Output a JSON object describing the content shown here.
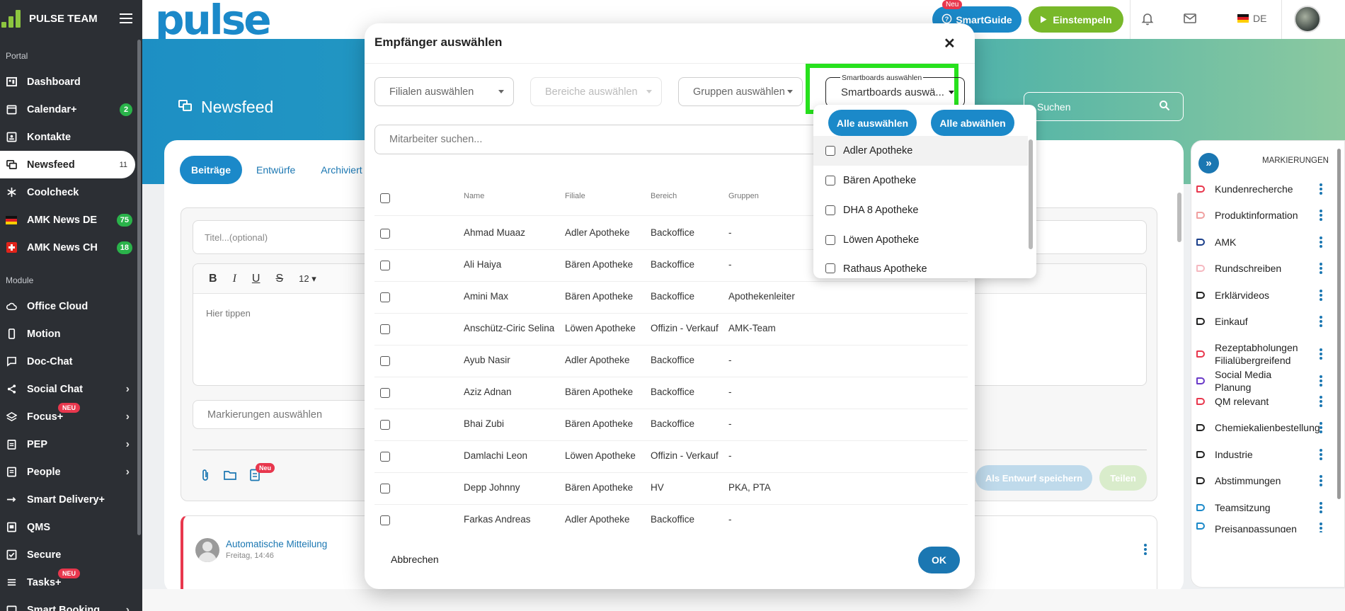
{
  "sidebar": {
    "title": "PULSE TEAM",
    "section_portal": "Portal",
    "section_module": "Module",
    "portal_items": [
      {
        "label": "Dashboard"
      },
      {
        "label": "Calendar+",
        "badge": "2"
      },
      {
        "label": "Kontakte"
      },
      {
        "label": "Newsfeed",
        "count": "11"
      },
      {
        "label": "Coolcheck"
      },
      {
        "label": "AMK News DE",
        "badge": "75"
      },
      {
        "label": "AMK News CH",
        "badge": "18"
      }
    ],
    "module_items": [
      {
        "label": "Office Cloud"
      },
      {
        "label": "Motion"
      },
      {
        "label": "Doc-Chat"
      },
      {
        "label": "Social Chat"
      },
      {
        "label": "Focus+",
        "neu": "NEU"
      },
      {
        "label": "PEP"
      },
      {
        "label": "People"
      },
      {
        "label": "Smart Delivery+"
      },
      {
        "label": "QMS"
      },
      {
        "label": "Secure"
      },
      {
        "label": "Tasks+",
        "neu": "NEU"
      },
      {
        "label": "Smart Booking"
      }
    ]
  },
  "topbar": {
    "brand": "pulse",
    "smartguide_label": "SmartGuide",
    "smartguide_badge": "Neu",
    "stamp_label": "Einstempeln",
    "lang": "DE"
  },
  "page": {
    "title": "Newsfeed",
    "search_placeholder": "Suchen",
    "tabs": [
      "Beiträge",
      "Entwürfe",
      "Archiviert"
    ],
    "title_placeholder": "Titel...(optional)",
    "font_size": "12",
    "editor_placeholder": "Hier tippen",
    "marks_placeholder": "Markierungen auswählen",
    "attach_badge": "Neu",
    "draft_button": "Als Entwurf speichern",
    "share_button": "Teilen",
    "post_author": "Automatische Mitteilung",
    "post_date": "Freitag, 14:46"
  },
  "right_panel": {
    "title": "MARKIERUNGEN",
    "items": [
      {
        "label": "Kundenrecherche",
        "color": "#e8374d"
      },
      {
        "label": "Produktinformation",
        "color": "#f0a0a0"
      },
      {
        "label": "AMK",
        "color": "#1b3f8a"
      },
      {
        "label": "Rundschreiben",
        "color": "#f5b8c0"
      },
      {
        "label": "Erklärvideos",
        "color": "#222222"
      },
      {
        "label": "Einkauf",
        "color": "#222222"
      },
      {
        "label": "Rezeptabholungen Filialübergreifend",
        "color": "#e8374d"
      },
      {
        "label": "Social Media Planung",
        "color": "#6a3ac8"
      },
      {
        "label": "QM relevant",
        "color": "#e8374d"
      },
      {
        "label": "Chemiekalienbestellung",
        "color": "#222222"
      },
      {
        "label": "Industrie",
        "color": "#222222"
      },
      {
        "label": "Abstimmungen",
        "color": "#222222"
      },
      {
        "label": "Teamsitzung",
        "color": "#1b89c9"
      },
      {
        "label": "Preisanpassungen",
        "color": "#1b89c9"
      }
    ]
  },
  "modal": {
    "title": "Empfänger auswählen",
    "filter_branches": "Filialen auswählen",
    "filter_areas": "Bereiche auswählen",
    "filter_groups": "Gruppen auswählen",
    "smartboards_label": "Smartboards auswählen",
    "smartboards_value": "Smartboards auswä...",
    "search_placeholder": "Mitarbeiter suchen...",
    "columns": [
      "Name",
      "Filiale",
      "Bereich",
      "Gruppen"
    ],
    "rows": [
      {
        "name": "Ahmad Muaaz",
        "branch": "Adler Apotheke",
        "area": "Backoffice",
        "groups": "-"
      },
      {
        "name": "Ali Haiya",
        "branch": "Bären Apotheke",
        "area": "Backoffice",
        "groups": "-"
      },
      {
        "name": "Amini Max",
        "branch": "Bären Apotheke",
        "area": "Backoffice",
        "groups": "Apothekenleiter"
      },
      {
        "name": "Anschütz-Ciric Selina",
        "branch": "Löwen Apotheke",
        "area": "Offizin - Verkauf",
        "groups": "AMK-Team"
      },
      {
        "name": "Ayub Nasir",
        "branch": "Adler Apotheke",
        "area": "Backoffice",
        "groups": "-"
      },
      {
        "name": "Aziz Adnan",
        "branch": "Bären Apotheke",
        "area": "Backoffice",
        "groups": "-"
      },
      {
        "name": "Bhai Zubi",
        "branch": "Bären Apotheke",
        "area": "Backoffice",
        "groups": "-"
      },
      {
        "name": "Damlachi Leon",
        "branch": "Löwen Apotheke",
        "area": "Offizin - Verkauf",
        "groups": "-"
      },
      {
        "name": "Depp Johnny",
        "branch": "Bären Apotheke",
        "area": "HV",
        "groups": "PKA, PTA"
      },
      {
        "name": "Farkas Andreas",
        "branch": "Adler Apotheke",
        "area": "Backoffice",
        "groups": "-"
      }
    ],
    "cancel": "Abbrechen",
    "ok": "OK"
  },
  "smartboards_dropdown": {
    "select_all": "Alle auswählen",
    "deselect_all": "Alle abwählen",
    "options": [
      "Adler Apotheke",
      "Bären Apotheke",
      "DHA 8 Apotheke",
      "Löwen Apotheke",
      "Rathaus Apotheke"
    ]
  },
  "colors": {
    "primary": "#1b89c9",
    "green": "#78b82a",
    "badge_green": "#2ab34a",
    "alert_red": "#e8374d",
    "highlight": "#27e11d"
  }
}
